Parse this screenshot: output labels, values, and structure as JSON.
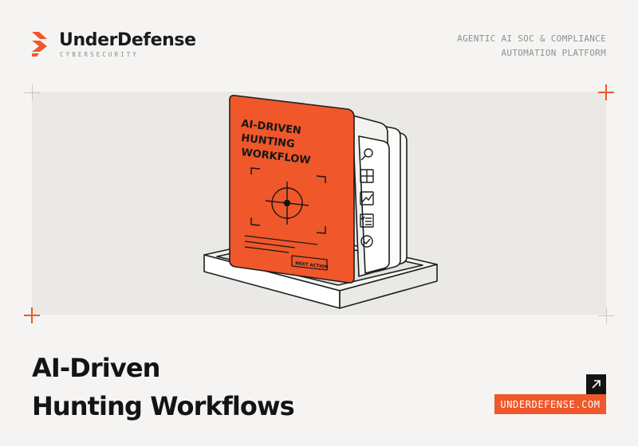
{
  "brand": {
    "name": "UnderDefense",
    "subtitle": "CYBERSECURITY",
    "accent_color": "#f0572a"
  },
  "tagline": {
    "line1": "AGENTIC AI SOC & COMPLIANCE",
    "line2": "AUTOMATION PLATFORM"
  },
  "illustration": {
    "card_title": [
      "AI-DRIVEN",
      "HUNTING",
      "WORKFLOW"
    ],
    "card_button": "NEXT ACTION",
    "side_icons": [
      "search-icon",
      "grid-icon",
      "chart-icon",
      "checklist-icon",
      "check-circle-icon"
    ]
  },
  "headline": {
    "line1": "AI-Driven",
    "line2": "Hunting Workflows"
  },
  "cta": {
    "url_label": "UNDERDEFENSE.COM",
    "arrow_icon": "arrow-up-right-icon"
  }
}
